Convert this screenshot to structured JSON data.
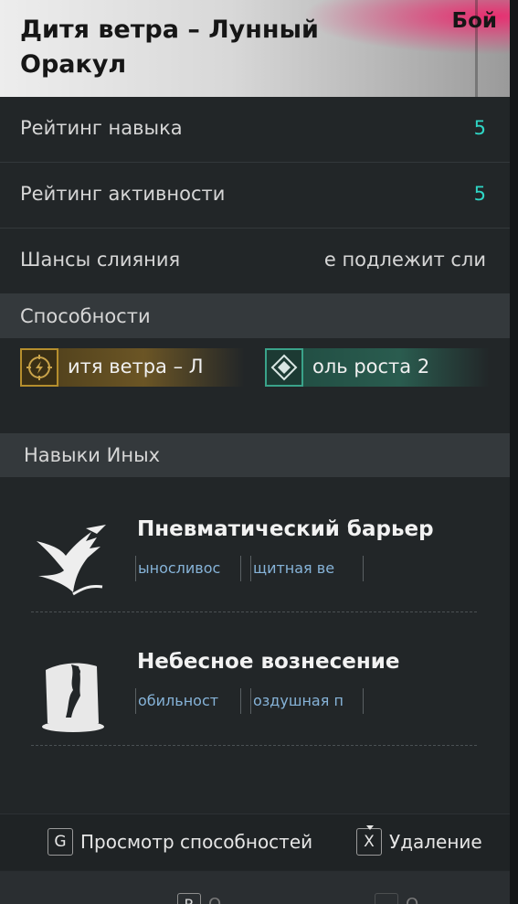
{
  "header": {
    "title": "Дитя ветра – Лунный Оракул",
    "tag": "Бой"
  },
  "stats": [
    {
      "label": "Рейтинг навыка",
      "value": "5"
    },
    {
      "label": "Рейтинг активности",
      "value": "5"
    },
    {
      "label": "Шансы слияния",
      "value": "е подлежит сли"
    }
  ],
  "sections": {
    "abilities": "Способности",
    "other_skills": "Навыки Иных"
  },
  "abilities": [
    {
      "text": "итя ветра – Л",
      "icon": "lightning-circle-icon",
      "color": "#b58e2d"
    },
    {
      "text": "оль роста 2",
      "icon": "diamond-icon",
      "color": "#3aa38a"
    }
  ],
  "other_skills": [
    {
      "name": "Пневматический барьер",
      "tags": [
        "ыносливос",
        "щитная ве"
      ],
      "icon": "wind-barrier-icon"
    },
    {
      "name": "Небесное вознесение",
      "tags": [
        "обильност",
        "оздушная п"
      ],
      "icon": "ascension-icon"
    }
  ],
  "footer": {
    "view": {
      "key": "G",
      "label": "Просмотр способностей"
    },
    "remove": {
      "key": "X",
      "label": "Удаление"
    }
  },
  "bottom": {
    "key1": "R",
    "label1": "О",
    "key2": "",
    "label2": "О"
  },
  "colors": {
    "accent_value": "#2fd6c6",
    "tag_text": "#86b3d8",
    "header_pink": "#ec286e"
  }
}
